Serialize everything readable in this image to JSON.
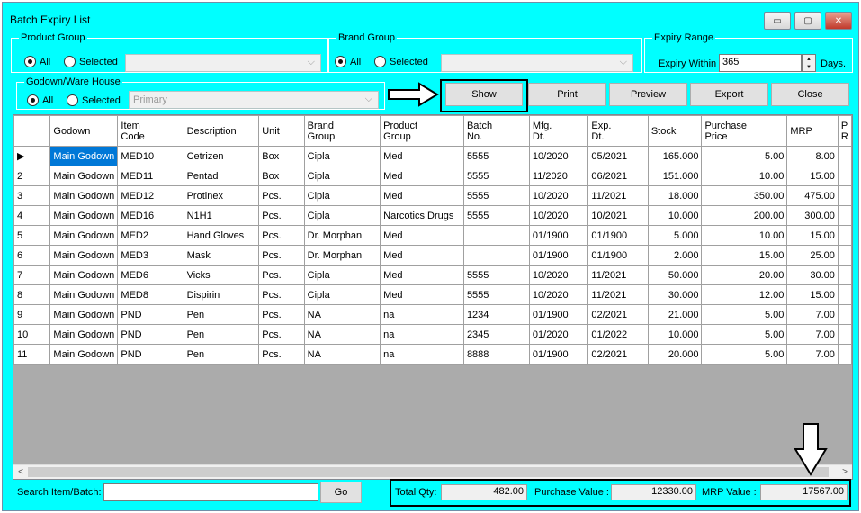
{
  "window": {
    "title": "Batch Expiry List",
    "minimize_label": "▭",
    "maximize_label": "▢",
    "close_label": "✕"
  },
  "product_group": {
    "legend": "Product Group",
    "all_label": "All",
    "selected_label": "Selected",
    "all_checked": true
  },
  "brand_group": {
    "legend": "Brand Group",
    "all_label": "All",
    "selected_label": "Selected",
    "all_checked": true
  },
  "expiry_range": {
    "legend": "Expiry Range",
    "within_label": "Expiry Within",
    "value": "365",
    "days_label": "Days."
  },
  "godown": {
    "legend": "Godown/Ware House",
    "all_label": "All",
    "selected_label": "Selected",
    "combo_value": "Primary",
    "all_checked": true
  },
  "buttons": {
    "show": "Show",
    "print": "Print",
    "preview": "Preview",
    "export": "Export",
    "close": "Close",
    "go": "Go"
  },
  "table": {
    "columns": [
      {
        "key": "row",
        "label": ""
      },
      {
        "key": "godown",
        "label": "Godown"
      },
      {
        "key": "code",
        "label": "Item\nCode"
      },
      {
        "key": "desc",
        "label": "Description"
      },
      {
        "key": "unit",
        "label": "Unit"
      },
      {
        "key": "brand",
        "label": "Brand\nGroup"
      },
      {
        "key": "pgroup",
        "label": "Product\nGroup"
      },
      {
        "key": "batch",
        "label": "Batch\nNo."
      },
      {
        "key": "mfg",
        "label": "Mfg.\nDt."
      },
      {
        "key": "exp",
        "label": "Exp.\nDt."
      },
      {
        "key": "stock",
        "label": "Stock"
      },
      {
        "key": "pprice",
        "label": "Purchase\nPrice"
      },
      {
        "key": "mrp",
        "label": "MRP"
      },
      {
        "key": "extra",
        "label": "P\nR"
      }
    ],
    "rows": [
      {
        "row": "▶",
        "godown": "Main Godown",
        "code": "MED10",
        "desc": "Cetrizen",
        "unit": "Box",
        "brand": "Cipla",
        "pgroup": "Med",
        "batch": "5555",
        "mfg": "10/2020",
        "exp": "05/2021",
        "stock": "165.000",
        "pprice": "5.00",
        "mrp": "8.00"
      },
      {
        "row": "2",
        "godown": "Main Godown",
        "code": "MED11",
        "desc": "Pentad",
        "unit": "Box",
        "brand": "Cipla",
        "pgroup": "Med",
        "batch": "5555",
        "mfg": "11/2020",
        "exp": "06/2021",
        "stock": "151.000",
        "pprice": "10.00",
        "mrp": "15.00"
      },
      {
        "row": "3",
        "godown": "Main Godown",
        "code": "MED12",
        "desc": "Protinex",
        "unit": "Pcs.",
        "brand": "Cipla",
        "pgroup": "Med",
        "batch": "5555",
        "mfg": "10/2020",
        "exp": "11/2021",
        "stock": "18.000",
        "pprice": "350.00",
        "mrp": "475.00"
      },
      {
        "row": "4",
        "godown": "Main Godown",
        "code": "MED16",
        "desc": "N1H1",
        "unit": "Pcs.",
        "brand": "Cipla",
        "pgroup": "Narcotics Drugs",
        "batch": "5555",
        "mfg": "10/2020",
        "exp": "10/2021",
        "stock": "10.000",
        "pprice": "200.00",
        "mrp": "300.00"
      },
      {
        "row": "5",
        "godown": "Main Godown",
        "code": "MED2",
        "desc": "Hand Gloves",
        "unit": "Pcs.",
        "brand": "Dr. Morphan",
        "pgroup": "Med",
        "batch": "",
        "mfg": "01/1900",
        "exp": "01/1900",
        "stock": "5.000",
        "pprice": "10.00",
        "mrp": "15.00"
      },
      {
        "row": "6",
        "godown": "Main Godown",
        "code": "MED3",
        "desc": "Mask",
        "unit": "Pcs.",
        "brand": "Dr. Morphan",
        "pgroup": "Med",
        "batch": "",
        "mfg": "01/1900",
        "exp": "01/1900",
        "stock": "2.000",
        "pprice": "15.00",
        "mrp": "25.00"
      },
      {
        "row": "7",
        "godown": "Main Godown",
        "code": "MED6",
        "desc": "Vicks",
        "unit": "Pcs.",
        "brand": "Cipla",
        "pgroup": "Med",
        "batch": "5555",
        "mfg": "10/2020",
        "exp": "11/2021",
        "stock": "50.000",
        "pprice": "20.00",
        "mrp": "30.00"
      },
      {
        "row": "8",
        "godown": "Main Godown",
        "code": "MED8",
        "desc": "Dispirin",
        "unit": "Pcs.",
        "brand": "Cipla",
        "pgroup": "Med",
        "batch": "5555",
        "mfg": "10/2020",
        "exp": "11/2021",
        "stock": "30.000",
        "pprice": "12.00",
        "mrp": "15.00"
      },
      {
        "row": "9",
        "godown": "Main Godown",
        "code": "PND",
        "desc": "Pen",
        "unit": "Pcs.",
        "brand": "NA",
        "pgroup": "na",
        "batch": "1234",
        "mfg": "01/1900",
        "exp": "02/2021",
        "stock": "21.000",
        "pprice": "5.00",
        "mrp": "7.00"
      },
      {
        "row": "10",
        "godown": "Main Godown",
        "code": "PND",
        "desc": "Pen",
        "unit": "Pcs.",
        "brand": "NA",
        "pgroup": "na",
        "batch": "2345",
        "mfg": "01/2020",
        "exp": "01/2022",
        "stock": "10.000",
        "pprice": "5.00",
        "mrp": "7.00"
      },
      {
        "row": "11",
        "godown": "Main Godown",
        "code": "PND",
        "desc": "Pen",
        "unit": "Pcs.",
        "brand": "NA",
        "pgroup": "na",
        "batch": "8888",
        "mfg": "01/1900",
        "exp": "02/2021",
        "stock": "20.000",
        "pprice": "5.00",
        "mrp": "7.00"
      }
    ]
  },
  "search": {
    "label": "Search Item/Batch:",
    "value": ""
  },
  "totals": {
    "qty_label": "Total Qty:",
    "qty_value": "482.00",
    "purchase_label": "Purchase Value :",
    "purchase_value": "12330.00",
    "mrp_label": "MRP Value :",
    "mrp_value": "17567.00"
  },
  "colors": {
    "background": "#00ffff",
    "selected_cell": "#0078d7"
  }
}
